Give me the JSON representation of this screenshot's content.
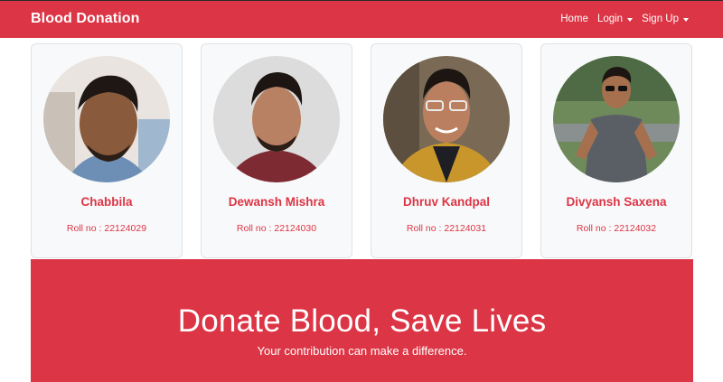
{
  "navbar": {
    "brand": "Blood Donation",
    "links": [
      {
        "label": "Home",
        "dropdown": false
      },
      {
        "label": "Login",
        "dropdown": true
      },
      {
        "label": "Sign Up",
        "dropdown": true
      }
    ]
  },
  "members": [
    {
      "name": "Chabbila",
      "roll": "Roll no : 22124029"
    },
    {
      "name": "Dewansh Mishra",
      "roll": "Roll no : 22124030"
    },
    {
      "name": "Dhruv Kandpal",
      "roll": "Roll no : 22124031"
    },
    {
      "name": "Divyansh Saxena",
      "roll": "Roll no : 22124032"
    }
  ],
  "hero": {
    "title": "Donate Blood, Save Lives",
    "subtitle": "Your contribution can make a difference."
  },
  "colors": {
    "accent": "#dc3545",
    "card_bg": "#f8f9fa"
  }
}
